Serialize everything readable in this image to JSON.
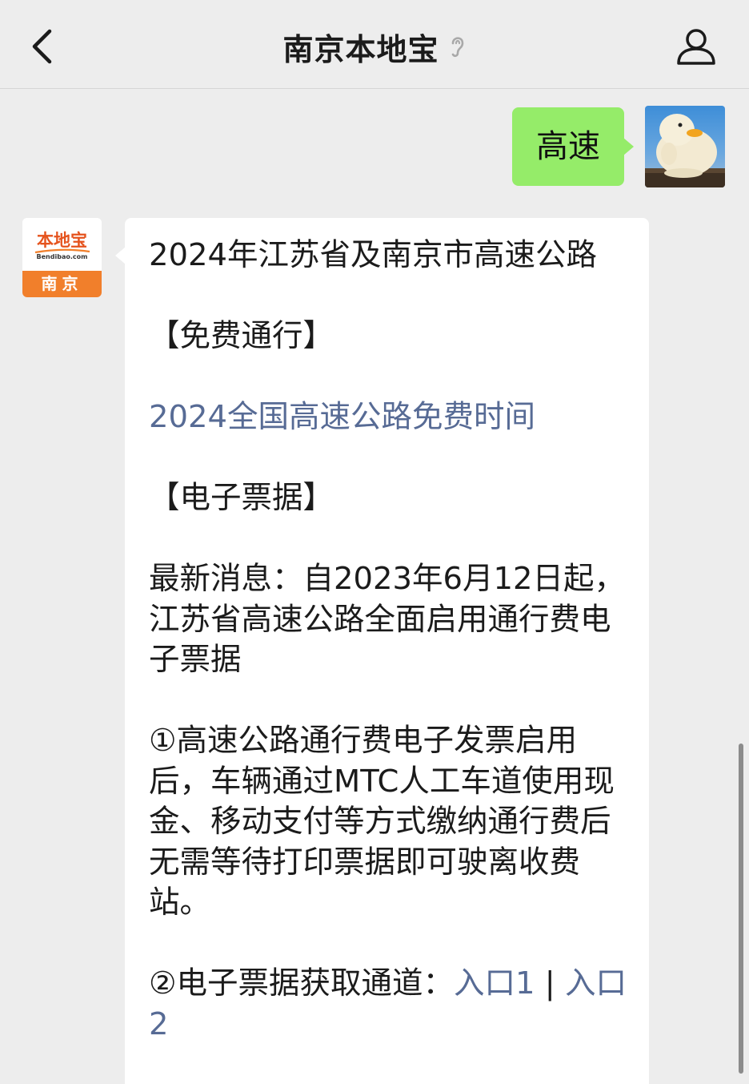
{
  "header": {
    "title": "南京本地宝",
    "back_icon": "chevron-left-icon",
    "ear_icon": "ear-icon",
    "profile_icon": "person-icon"
  },
  "messages": {
    "outgoing": {
      "text": "高速"
    },
    "incoming": {
      "avatar": {
        "logo_text": "本地宝",
        "url_text": "Bendibao.com",
        "city": "南京"
      },
      "line1": "2024年江苏省及南京市高速公路",
      "section1": "【免费通行】",
      "link1": "2024全国高速公路免费时间",
      "section2": "【电子票据】",
      "news": "最新消息：自2023年6月12日起，江苏省高速公路全面启用通行费电子票据",
      "point1": "①高速公路通行费电子发票启用后，车辆通过MTC人工车道使用现金、移动支付等方式缴纳通行费后无需等待打印票据即可驶离收费站。",
      "point2_prefix": "②电子票据获取通道：",
      "point2_link1": "入口1",
      "point2_sep": " | ",
      "point2_link2": "入口2"
    }
  },
  "colors": {
    "background": "#ededed",
    "bubble_out": "#95ec69",
    "bubble_in": "#ffffff",
    "link": "#576b95",
    "brand_orange": "#f17f2b"
  }
}
